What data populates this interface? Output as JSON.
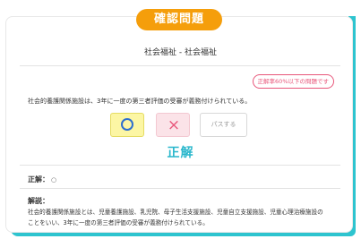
{
  "header": {
    "title": "確認問題"
  },
  "question": {
    "category": "社会福祉 - 社会福祉",
    "badge": "正解率60%以下の問題です",
    "text": "社会的養護関係施設は、3年に一度の第三者評価の受審が義務付けられている。"
  },
  "answer_buttons": {
    "true_icon": "circle-icon",
    "false_symbol": "×",
    "pass_label": "パスする"
  },
  "result": {
    "label": "正解"
  },
  "correct_answer": {
    "label": "正解：",
    "value": "○"
  },
  "explanation": {
    "title": "解説：",
    "line1": "社会的養護関係施設とは、児童養護施設、乳児院、母子生活支援施設、児童自立支援施設、児童心理治療施設の",
    "line2": "ことをいい、3年に一度の第三者評価の受審が義務付けられている。"
  },
  "colors": {
    "accent_orange": "#f59e0b",
    "teal": "#2ec4cf",
    "result_blue": "#2ab7cc",
    "circle_blue": "#2e6fcf",
    "pink": "#e8567a"
  }
}
